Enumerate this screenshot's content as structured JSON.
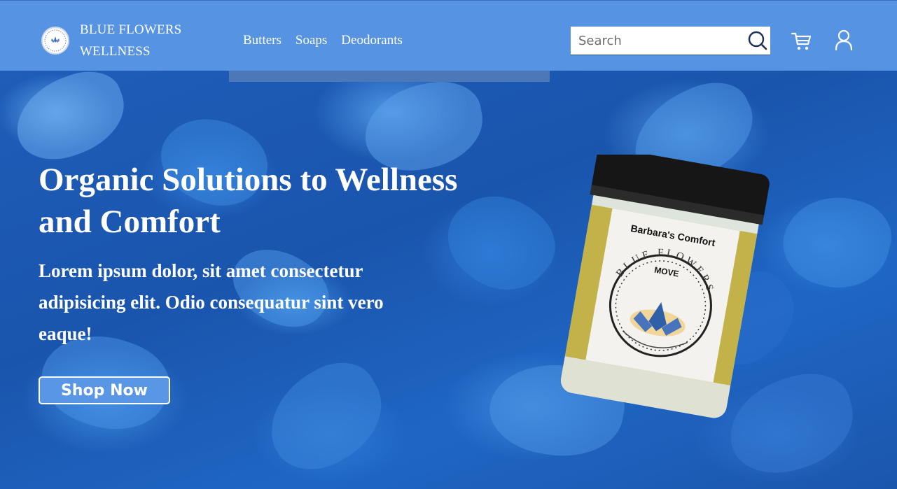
{
  "header": {
    "brand_line1": "BLUE FLOWERS",
    "brand_line2": "WELLNESS",
    "logo_icon": "lotus-logo-icon",
    "nav": [
      {
        "label": "Butters"
      },
      {
        "label": "Soaps"
      },
      {
        "label": "Deodorants"
      }
    ],
    "search": {
      "placeholder": "Search",
      "value": ""
    },
    "icons": {
      "search": "search-icon",
      "cart": "cart-icon",
      "account": "user-icon"
    },
    "colors": {
      "header_bg": "#5693e3",
      "accent": "#5a96e6"
    }
  },
  "hero": {
    "title": "Organic Solutions to Wellness and Comfort",
    "text": "Lorem ipsum dolor, sit amet consectetur adipisicing elit. Odio consequatur sint vero eaque!",
    "cta_label": "Shop Now",
    "product": {
      "label_top": "Barbara's Comfort",
      "label_arc": "BLUE FLOWERS",
      "label_sub": "MOVE"
    },
    "background": "blue-hydrangea-petals"
  }
}
